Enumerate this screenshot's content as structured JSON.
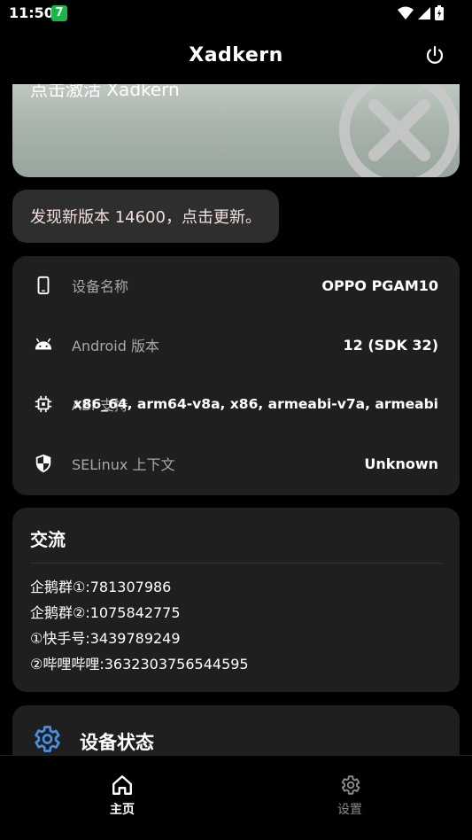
{
  "status_bar": {
    "time": "11:50",
    "badge": "7"
  },
  "app_bar": {
    "title": "Xadkern",
    "power_icon": "power-icon"
  },
  "banner": {
    "text": "点击激活 Xadkern",
    "icon": "close-circle-icon"
  },
  "update_notice": {
    "text": "发现新版本 14600，点击更新。"
  },
  "device_info": {
    "rows": [
      {
        "icon": "phone-icon",
        "label": "设备名称",
        "value": "OPPO PGAM10"
      },
      {
        "icon": "android-icon",
        "label": "Android 版本",
        "value": "12 (SDK 32)"
      },
      {
        "icon": "chip-icon",
        "label": "ABI 支持",
        "value": "x86_64, arm64-v8a, x86, armeabi-v7a, armeabi"
      },
      {
        "icon": "shield-icon",
        "label": "SELinux 上下文",
        "value": "Unknown"
      }
    ]
  },
  "communication": {
    "title": "交流",
    "items": [
      "企鹅群①:781307986",
      "企鹅群②:1075842775",
      "①快手号:3439789249",
      "②哔哩哔哩:3632303756544595"
    ]
  },
  "device_status": {
    "title": "设备状态",
    "icon": "gear-icon"
  },
  "bottom_nav": {
    "items": [
      {
        "label": "主页",
        "icon": "home-icon",
        "active": true
      },
      {
        "label": "设置",
        "icon": "gear-icon",
        "active": false
      }
    ]
  },
  "colors": {
    "accent": "#4a90e2",
    "card": "#1f1f1f",
    "badge": "#19b64a"
  }
}
